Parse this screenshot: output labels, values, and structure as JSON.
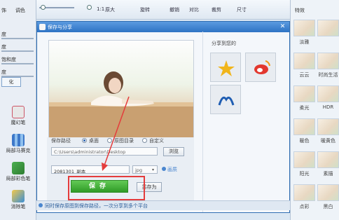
{
  "toolbar": {
    "zoom_ratio": "1:1",
    "zoom_original": "原大",
    "rotate": "旋转",
    "undo": "撤销",
    "compare": "对比",
    "crop": "裁剪",
    "size": "尺寸"
  },
  "left_panel": {
    "tabs": [
      "饰",
      "调色"
    ],
    "sliders": [
      "度",
      "度",
      "饱和度",
      "度"
    ],
    "apply_label": "化",
    "tools": [
      "魔幻笔",
      "局部马赛克",
      "局部彩色笔",
      "消除笔"
    ]
  },
  "right_panel": {
    "header": "特效",
    "thumbs": [
      "",
      "",
      "",
      "",
      "",
      "",
      "",
      "",
      "",
      "",
      "",
      ""
    ],
    "labels": [
      "淡雅",
      "",
      "云云",
      "时尚生活",
      "柔光",
      "HDR",
      "暖色",
      "暖黄色",
      "阳光",
      "素描",
      "点彩",
      "黑白"
    ]
  },
  "dialog": {
    "title": "保存与分享",
    "share_label": "分享到您的",
    "path_label": "保存路径",
    "options": [
      "桌面",
      "原图目录",
      "自定义"
    ],
    "path_value": "C:\\Users\\administrator\\Desktop",
    "browse": "浏览",
    "filename_value": "2081301_副本",
    "format_value": "jpg",
    "save": "保存",
    "save_as": "另存为",
    "quality_label": "画质",
    "status_text": "同时保存原图到保存路径，一次分享到多个平台"
  },
  "colors": {
    "title_bar": "#2e73c4",
    "save_green": "#3fae34",
    "highlight_red": "#e43c3c"
  }
}
